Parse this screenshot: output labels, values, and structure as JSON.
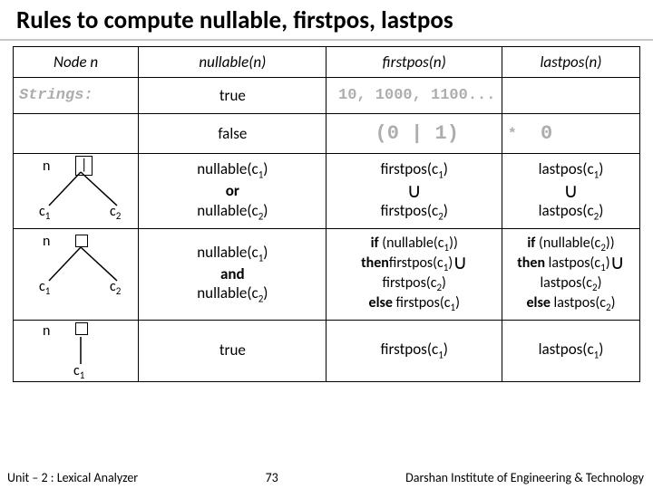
{
  "title": "Rules to compute nullable, firstpos, lastpos",
  "headers": {
    "node": "Node n",
    "nullable": "nullable(n)",
    "firstpos": "firstpos(n)",
    "lastpos": "lastpos(n)"
  },
  "rows": {
    "r1": {
      "nullable": "true"
    },
    "r2": {
      "nullable": "false"
    },
    "r3": {
      "nullable_l1": "nullable(c",
      "nullable_l1_sub": "1",
      "nullable_l2": "or",
      "nullable_l3": "nullable(c",
      "nullable_l3_sub": "2",
      "firstpos_l1": "firstpos(c",
      "firstpos_l1_sub": "1",
      "firstpos_l2": "firstpos(c",
      "firstpos_l2_sub": "2",
      "lastpos_l1": "lastpos(c",
      "lastpos_l1_sub": "1",
      "lastpos_l2": "lastpos(c",
      "lastpos_l2_sub": "2"
    },
    "r4": {
      "nullable_l1": "nullable(c",
      "nullable_l1_sub": "1",
      "nullable_l2": "and",
      "nullable_l3": "nullable(c",
      "nullable_l3_sub": "2",
      "fp_if": "if",
      "fp_cond": " (nullable(c",
      "fp_cond_sub": "1",
      "fp_cond_end": "))",
      "fp_then": "then",
      "fp_then_a": "firstpos(c",
      "fp_then_a_sub": "1",
      "fp_then_b": "firstpos(c",
      "fp_then_b_sub": "2",
      "fp_else": "else",
      "fp_else_a": " firstpos(c",
      "fp_else_a_sub": "1",
      "lp_if": "if",
      "lp_cond": " (nullable(c",
      "lp_cond_sub": "2",
      "lp_cond_end": "))",
      "lp_then": "then",
      "lp_then_a": " lastpos(c",
      "lp_then_a_sub": "1",
      "lp_then_b": "lastpos(c",
      "lp_then_b_sub": "2",
      "lp_else": "else",
      "lp_else_a": " lastpos(c",
      "lp_else_a_sub": "2"
    },
    "r5": {
      "nullable": "true",
      "firstpos": "firstpos(c",
      "firstpos_sub": "1",
      "lastpos": "lastpos(c",
      "lastpos_sub": "1"
    }
  },
  "tree_labels": {
    "n": "n",
    "pipe": "|",
    "c1": "c",
    "c1_sub": "1",
    "c2": "c",
    "c2_sub": "2"
  },
  "bg": {
    "strings": "Strings:",
    "nums": "10, 1000, 1100...",
    "regex": "(0 | 1)",
    "star": "*",
    "zero": "0"
  },
  "footer": {
    "unit": "Unit – 2  : Lexical Analyzer",
    "page": "73",
    "inst": "Darshan Institute of Engineering & Technology"
  }
}
